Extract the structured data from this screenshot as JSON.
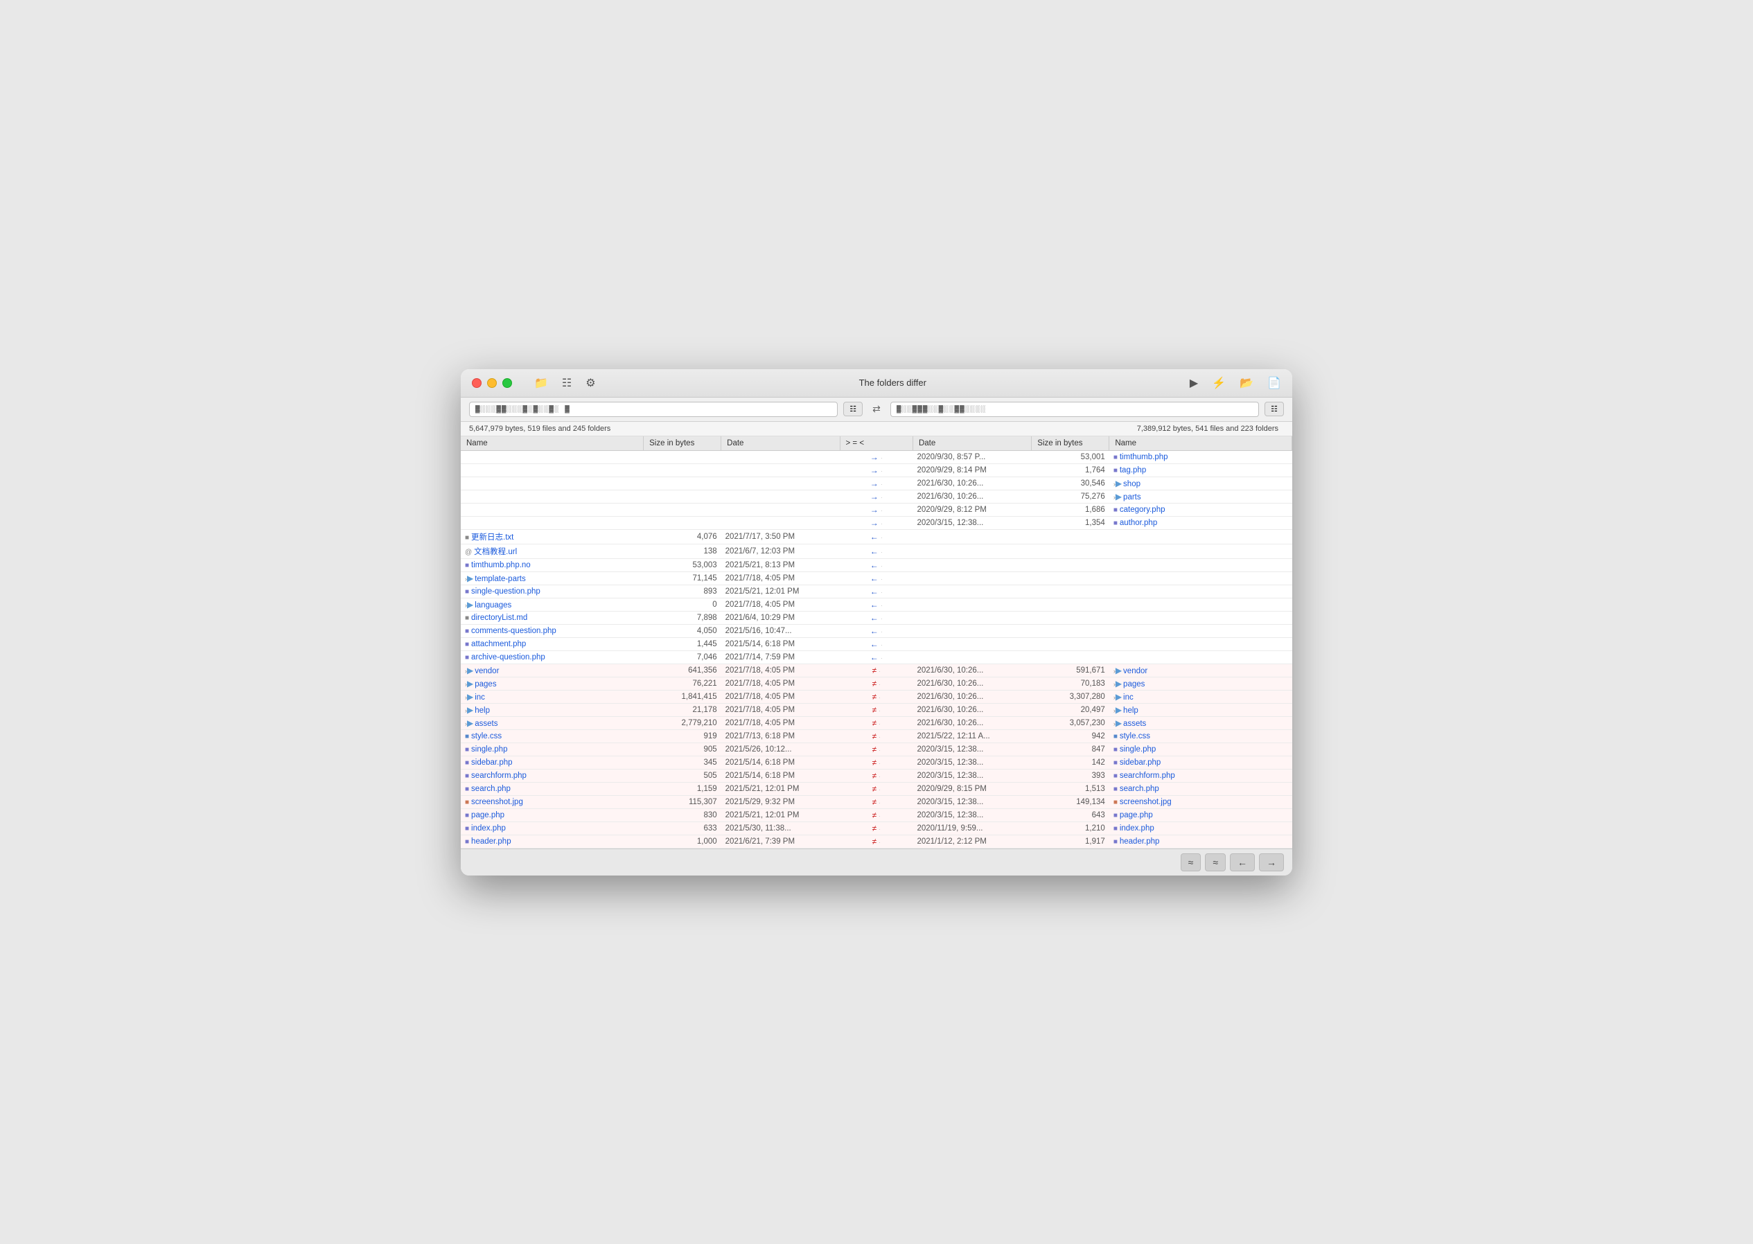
{
  "window": {
    "title": "The folders differ"
  },
  "titlebar": {
    "toolbar_icons": [
      "folder-open",
      "list",
      "gear"
    ],
    "right_icons": [
      "play",
      "lightning",
      "folder",
      "doc"
    ]
  },
  "pathbar": {
    "left_path": "▓░░░▓▓░░░▓░▓░░▓░ ▓",
    "right_path": "▓░░▓▓▓░░▓░░▓▓░░░░",
    "swap_label": "⇄"
  },
  "stats": {
    "left": "5,647,979 bytes, 519 files and 245 folders",
    "right": "7,389,912 bytes, 541 files and 223 folders"
  },
  "columns": {
    "left_name": "Name",
    "left_size": "Size in bytes",
    "left_date": "Date",
    "arrows": "> = <",
    "right_date": "Date",
    "right_size": "Size in bytes",
    "right_name": "Name"
  },
  "rows": [
    {
      "type": "right-only",
      "left_name": "",
      "left_size": "",
      "left_date": "",
      "arrow": "→",
      "dot": "·",
      "right_date": "2020/9/30, 8:57 P...",
      "right_size": "53,001",
      "right_name": "timthumb.php",
      "right_icon": "php"
    },
    {
      "type": "right-only",
      "left_name": "",
      "left_size": "",
      "left_date": "",
      "arrow": "→",
      "dot": "·",
      "right_date": "2020/9/29, 8:14 PM",
      "right_size": "1,764",
      "right_name": "tag.php",
      "right_icon": "php"
    },
    {
      "type": "right-only",
      "left_name": "",
      "left_size": "",
      "left_date": "",
      "arrow": "→",
      "dot": "·",
      "right_date": "2021/6/30, 10:26...",
      "right_size": "30,546",
      "right_name": "shop",
      "right_icon": "folder",
      "right_expand": "›"
    },
    {
      "type": "right-only",
      "left_name": "",
      "left_size": "",
      "left_date": "",
      "arrow": "→",
      "dot": "·",
      "right_date": "2021/6/30, 10:26...",
      "right_size": "75,276",
      "right_name": "parts",
      "right_icon": "folder",
      "right_expand": "›"
    },
    {
      "type": "right-only",
      "left_name": "",
      "left_size": "",
      "left_date": "",
      "arrow": "→",
      "dot": "·",
      "right_date": "2020/9/29, 8:12 PM",
      "right_size": "1,686",
      "right_name": "category.php",
      "right_icon": "php"
    },
    {
      "type": "right-only",
      "left_name": "",
      "left_size": "",
      "left_date": "",
      "arrow": "→",
      "dot": "·",
      "right_date": "2020/3/15, 12:38...",
      "right_size": "1,354",
      "right_name": "author.php",
      "right_icon": "php"
    },
    {
      "type": "left-only",
      "left_name": "更新日志.txt",
      "left_icon": "txt",
      "left_size": "4,076",
      "left_date": "2021/7/17, 3:50 PM",
      "arrow": "←",
      "dot": "·",
      "right_date": "",
      "right_size": "",
      "right_name": ""
    },
    {
      "type": "left-only",
      "left_name": "文档教程.url",
      "left_icon": "url",
      "left_size": "138",
      "left_date": "2021/6/7, 12:03 PM",
      "arrow": "←",
      "dot": "·",
      "right_date": "",
      "right_size": "",
      "right_name": ""
    },
    {
      "type": "left-only",
      "left_name": "timthumb.php.no",
      "left_icon": "php",
      "left_size": "53,003",
      "left_date": "2021/5/21, 8:13 PM",
      "arrow": "←",
      "dot": "·",
      "right_date": "",
      "right_size": "",
      "right_name": ""
    },
    {
      "type": "left-only",
      "left_name": "template-parts",
      "left_icon": "folder",
      "left_expand": "›",
      "left_size": "71,145",
      "left_date": "2021/7/18, 4:05 PM",
      "arrow": "←",
      "dot": "·",
      "right_date": "",
      "right_size": "",
      "right_name": ""
    },
    {
      "type": "left-only",
      "left_name": "single-question.php",
      "left_icon": "php",
      "left_size": "893",
      "left_date": "2021/5/21, 12:01 PM",
      "arrow": "←",
      "dot": "·",
      "right_date": "",
      "right_size": "",
      "right_name": ""
    },
    {
      "type": "left-only",
      "left_name": "languages",
      "left_icon": "folder",
      "left_expand": "›",
      "left_size": "0",
      "left_date": "2021/7/18, 4:05 PM",
      "arrow": "←",
      "dot": "·",
      "right_date": "",
      "right_size": "",
      "right_name": ""
    },
    {
      "type": "left-only",
      "left_name": "directoryList.md",
      "left_icon": "md",
      "left_size": "7,898",
      "left_date": "2021/6/4, 10:29 PM",
      "arrow": "←",
      "dot": "·",
      "right_date": "",
      "right_size": "",
      "right_name": ""
    },
    {
      "type": "left-only",
      "left_name": "comments-question.php",
      "left_icon": "php",
      "left_size": "4,050",
      "left_date": "2021/5/16, 10:47...",
      "arrow": "←",
      "dot": "·",
      "right_date": "",
      "right_size": "",
      "right_name": ""
    },
    {
      "type": "left-only",
      "left_name": "attachment.php",
      "left_icon": "php",
      "left_size": "1,445",
      "left_date": "2021/5/14, 6:18 PM",
      "arrow": "←",
      "dot": "·",
      "right_date": "",
      "right_size": "",
      "right_name": ""
    },
    {
      "type": "left-only",
      "left_name": "archive-question.php",
      "left_icon": "php",
      "left_size": "7,046",
      "left_date": "2021/7/14, 7:59 PM",
      "arrow": "←",
      "dot": "·",
      "right_date": "",
      "right_size": "",
      "right_name": ""
    },
    {
      "type": "diff",
      "left_name": "vendor",
      "left_icon": "folder",
      "left_expand": "›",
      "left_size": "641,356",
      "left_date": "2021/7/18, 4:05 PM",
      "arrow": "≠",
      "dot": "·",
      "right_date": "2021/6/30, 10:26...",
      "right_size": "591,671",
      "right_name": "vendor",
      "right_icon": "folder",
      "right_expand": "›"
    },
    {
      "type": "diff",
      "left_name": "pages",
      "left_icon": "folder",
      "left_expand": "›",
      "left_size": "76,221",
      "left_date": "2021/7/18, 4:05 PM",
      "arrow": "≠",
      "dot": "·",
      "right_date": "2021/6/30, 10:26...",
      "right_size": "70,183",
      "right_name": "pages",
      "right_icon": "folder",
      "right_expand": "›"
    },
    {
      "type": "diff",
      "left_name": "inc",
      "left_icon": "folder",
      "left_expand": "›",
      "left_size": "1,841,415",
      "left_date": "2021/7/18, 4:05 PM",
      "arrow": "≠",
      "dot": "·",
      "right_date": "2021/6/30, 10:26...",
      "right_size": "3,307,280",
      "right_name": "inc",
      "right_icon": "folder",
      "right_expand": "›"
    },
    {
      "type": "diff",
      "left_name": "help",
      "left_icon": "folder",
      "left_expand": "›",
      "left_size": "21,178",
      "left_date": "2021/7/18, 4:05 PM",
      "arrow": "≠",
      "dot": "·",
      "right_date": "2021/6/30, 10:26...",
      "right_size": "20,497",
      "right_name": "help",
      "right_icon": "folder",
      "right_expand": "›"
    },
    {
      "type": "diff",
      "left_name": "assets",
      "left_icon": "folder",
      "left_expand": "›",
      "left_size": "2,779,210",
      "left_date": "2021/7/18, 4:05 PM",
      "arrow": "≠",
      "dot": "·",
      "right_date": "2021/6/30, 10:26...",
      "right_size": "3,057,230",
      "right_name": "assets",
      "right_icon": "folder",
      "right_expand": "›"
    },
    {
      "type": "diff",
      "left_name": "style.css",
      "left_icon": "css",
      "left_size": "919",
      "left_date": "2021/7/13, 6:18 PM",
      "arrow": "≠",
      "dot": "·",
      "right_date": "2021/5/22, 12:11 A...",
      "right_size": "942",
      "right_name": "style.css",
      "right_icon": "css"
    },
    {
      "type": "diff",
      "left_name": "single.php",
      "left_icon": "php",
      "left_size": "905",
      "left_date": "2021/5/26, 10:12...",
      "arrow": "≠",
      "dot": "·",
      "right_date": "2020/3/15, 12:38...",
      "right_size": "847",
      "right_name": "single.php",
      "right_icon": "php"
    },
    {
      "type": "diff",
      "left_name": "sidebar.php",
      "left_icon": "php",
      "left_size": "345",
      "left_date": "2021/5/14, 6:18 PM",
      "arrow": "≠",
      "dot": "·",
      "right_date": "2020/3/15, 12:38...",
      "right_size": "142",
      "right_name": "sidebar.php",
      "right_icon": "php"
    },
    {
      "type": "diff",
      "left_name": "searchform.php",
      "left_icon": "php",
      "left_size": "505",
      "left_date": "2021/5/14, 6:18 PM",
      "arrow": "≠",
      "dot": "·",
      "right_date": "2020/3/15, 12:38...",
      "right_size": "393",
      "right_name": "searchform.php",
      "right_icon": "php"
    },
    {
      "type": "diff",
      "left_name": "search.php",
      "left_icon": "php",
      "left_size": "1,159",
      "left_date": "2021/5/21, 12:01 PM",
      "arrow": "≠",
      "dot": "·",
      "right_date": "2020/9/29, 8:15 PM",
      "right_size": "1,513",
      "right_name": "search.php",
      "right_icon": "php"
    },
    {
      "type": "diff",
      "left_name": "screenshot.jpg",
      "left_icon": "img",
      "left_size": "115,307",
      "left_date": "2021/5/29, 9:32 PM",
      "arrow": "≠",
      "dot": "·",
      "right_date": "2020/3/15, 12:38...",
      "right_size": "149,134",
      "right_name": "screenshot.jpg",
      "right_icon": "img"
    },
    {
      "type": "diff",
      "left_name": "page.php",
      "left_icon": "php",
      "left_size": "830",
      "left_date": "2021/5/21, 12:01 PM",
      "arrow": "≠",
      "dot": "·",
      "right_date": "2020/3/15, 12:38...",
      "right_size": "643",
      "right_name": "page.php",
      "right_icon": "php"
    },
    {
      "type": "diff",
      "left_name": "index.php",
      "left_icon": "php",
      "left_size": "633",
      "left_date": "2021/5/30, 11:38...",
      "arrow": "≠",
      "dot": "·",
      "right_date": "2020/11/19, 9:59...",
      "right_size": "1,210",
      "right_name": "index.php",
      "right_icon": "php"
    },
    {
      "type": "diff",
      "left_name": "header.php",
      "left_icon": "php",
      "left_size": "1,000",
      "left_date": "2021/6/21, 7:39 PM",
      "arrow": "≠",
      "dot": "·",
      "right_date": "2021/1/12, 2:12 PM",
      "right_size": "1,917",
      "right_name": "header.php",
      "right_icon": "php"
    }
  ],
  "bottom_nav": {
    "btn1": "≈",
    "btn2": "≈",
    "btn3": "←",
    "btn4": "→"
  }
}
